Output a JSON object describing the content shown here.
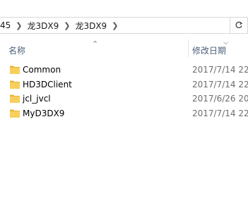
{
  "address": {
    "crumbs": [
      "45",
      "龙3DX9",
      "龙3DX9"
    ]
  },
  "header": {
    "name_label": "名称",
    "date_label": "修改日期"
  },
  "files": [
    {
      "name": "Common",
      "date": "2017/7/14 22:"
    },
    {
      "name": "HD3DClient",
      "date": "2017/7/14 22:"
    },
    {
      "name": "jcl_jvcl",
      "date": "2017/6/26 20:"
    },
    {
      "name": "MyD3DX9",
      "date": "2017/7/14 22:"
    }
  ],
  "icons": {
    "separator": "chevron-right-icon",
    "refresh": "refresh-icon",
    "dropdown": "chevron-down-icon",
    "sort": "sort-ascending-icon",
    "folder": "folder-icon"
  },
  "colors": {
    "folder": "#f5c44a",
    "header_text": "#4c607a",
    "date_text": "#6d6d6d"
  }
}
